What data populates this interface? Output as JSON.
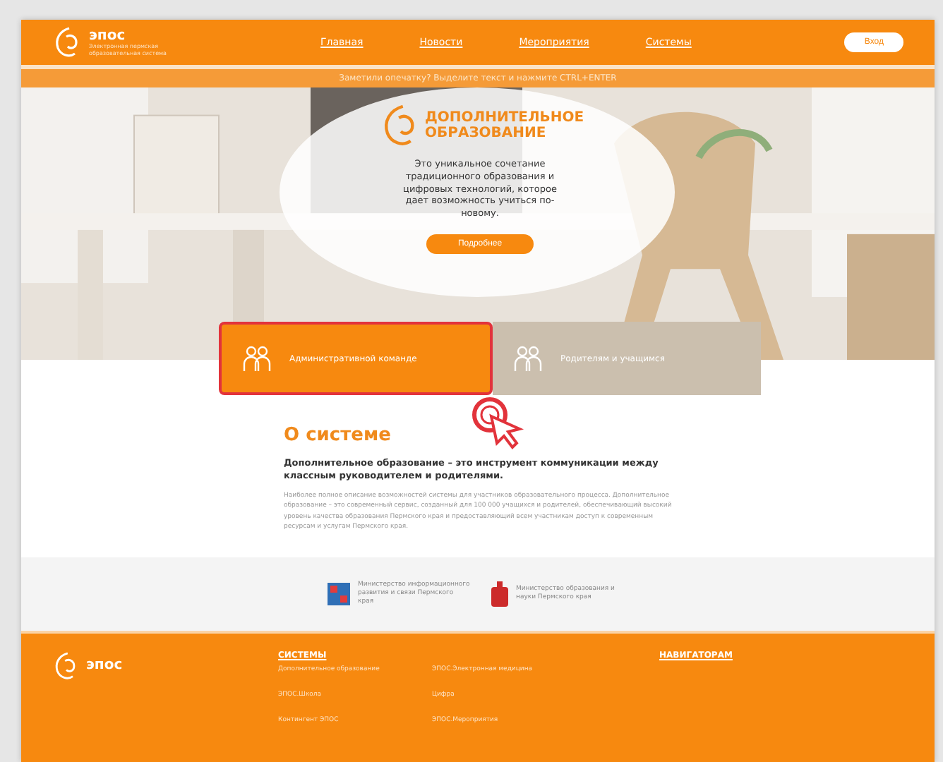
{
  "header": {
    "logo": "эпос",
    "logo_subtitle": "Электронная пермская образовательная система",
    "nav": [
      {
        "label": "Главная"
      },
      {
        "label": "Новости"
      },
      {
        "label": "Мероприятия"
      },
      {
        "label": "Системы"
      }
    ],
    "login_button": "Вход"
  },
  "notice": "Заметили опечатку? Выделите текст и нажмите CTRL+ENTER",
  "hero": {
    "kind": "picture",
    "title": "ДОПОЛНИТЕЛЬНОЕ ОБРАЗОВАНИЕ",
    "text": "Это уникальное сочетание традиционного образования и цифровых технологий, которое дает возможность учиться по-новому.",
    "button": "Подробнее"
  },
  "tabs": [
    {
      "label": "Административной команде",
      "selected": true
    },
    {
      "label": "Родителям и учащимся",
      "selected": false
    }
  ],
  "about": {
    "title": "О системе",
    "lead": "Дополнительное образование – это инструмент коммуникации между классным руководителем и родителями.",
    "text": "Наиболее полное описание возможностей системы для участников образовательного процесса. Дополнительное образование – это современный сервис, созданный для 100 000 учащихся и родителей, обеспечивающий высокий уровень качества образования Пермского края и предоставляющий всем участникам доступ к современным ресурсам и услугам Пермского края."
  },
  "partners": [
    {
      "name": "Министерство информационного развития и связи Пермского края"
    },
    {
      "name": "Министерство образования и науки Пермского края"
    }
  ],
  "footer": {
    "logo": "эпос",
    "systems_title": "СИСТЕМЫ",
    "links": [
      "Дополнительное образование",
      "ЭПОС.Электронная медицина",
      "ЭПОС.Школа",
      "Цифра",
      "Контингент ЭПОС",
      "ЭПОС.Мероприятия"
    ],
    "partners_title": "НАВИГАТОРАМ"
  }
}
